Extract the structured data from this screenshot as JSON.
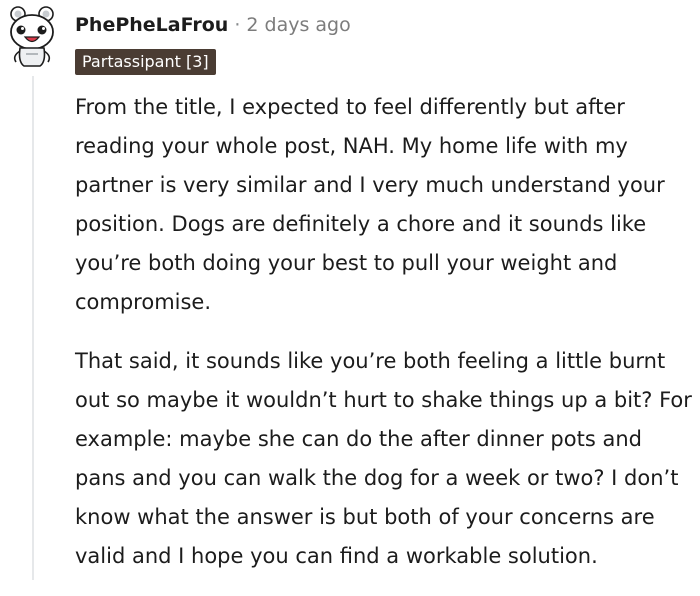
{
  "comment": {
    "username": "PhePheLaFrou",
    "separator": "·",
    "timestamp": "2 days ago",
    "flair": "Partassipant [3]",
    "avatar_icon": "snoo-avatar-icon",
    "paragraphs": [
      "From the title, I expected to feel differently but after reading your whole post, NAH. My home life with my partner is very similar and I very much understand your position. Dogs are definitely a chore and it sounds like you’re both doing your best to pull your weight and compromise.",
      "That said, it sounds like you’re both feeling a little burnt out so maybe it wouldn’t hurt to shake things up a bit? For example: maybe she can do the after dinner pots and pans and you can walk the dog for a week or two? I don’t know what the answer is but both of your concerns are valid and I hope you can find a workable solution."
    ]
  },
  "colors": {
    "username": "#1c1c1c",
    "timestamp": "#7c7c7c",
    "flair_bg": "#4a3c33",
    "flair_text": "#ffffff",
    "body_text": "#1c1c1c",
    "thread_line": "#e6e8ea"
  }
}
